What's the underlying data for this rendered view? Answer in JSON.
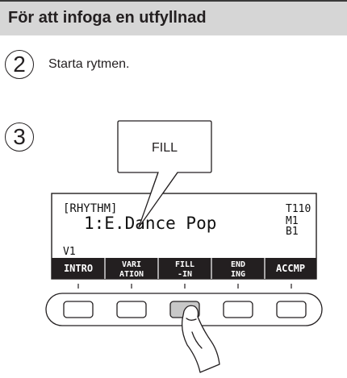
{
  "header": {
    "title": "För att infoga en utfyllnad"
  },
  "steps": [
    {
      "number": "2",
      "text": "Starta rytmen."
    },
    {
      "number": "3",
      "text": ""
    }
  ],
  "callout": {
    "label": "FILL"
  },
  "lcd": {
    "mode": "[RHYTHM]",
    "tempo": "T110",
    "measure": "M1",
    "beat": "B1",
    "rhythm_name": "1:E.Dance Pop",
    "variation": "V1",
    "buttons": [
      {
        "line1": "INTRO",
        "line2": ""
      },
      {
        "line1": "VARI",
        "line2": "ATION"
      },
      {
        "line1": "FILL",
        "line2": "-IN"
      },
      {
        "line1": "END",
        "line2": "ING"
      },
      {
        "line1": "ACCMP",
        "line2": ""
      }
    ]
  },
  "physical_buttons": {
    "count": 5,
    "pressed_index": 2
  }
}
